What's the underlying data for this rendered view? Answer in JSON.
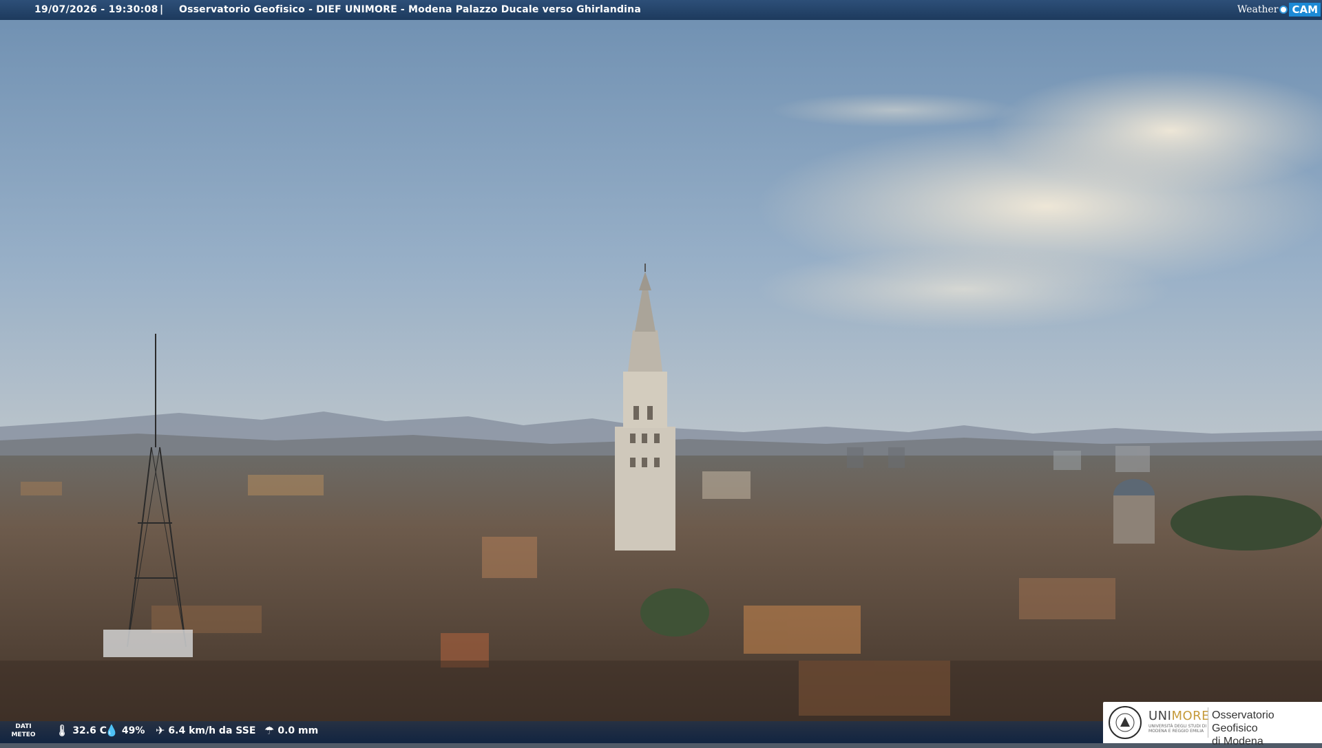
{
  "header": {
    "timestamp": "19/07/2026 - 19:30:08",
    "separator": "|",
    "title": "Osservatorio Geofisico - DIEF UNIMORE - Modena Palazzo Ducale verso Ghirlandina",
    "brand_part1": "Weather",
    "brand_part2": "CAM"
  },
  "weather": {
    "label_line1": "DATI",
    "label_line2": "METEO",
    "temperature": "32.6 C",
    "humidity": "49%",
    "wind": "6.4 km/h da SSE",
    "rain": "0.0 mm",
    "icons": [
      "thermometer-icon",
      "humidity-drop-icon",
      "wind-icon",
      "rain-gauge-icon"
    ]
  },
  "logo": {
    "unimore_a": "UNI",
    "unimore_b": "MORE",
    "university_line1": "UNIVERSITÀ DEGLI STUDI DI",
    "university_line2": "MODENA E REGGIO EMILIA",
    "observatory_line1": "Osservatorio Geofisico",
    "observatory_line2": "di Modena"
  },
  "colors": {
    "bar": "#1d3a5d",
    "brand_accent": "#1c8ad6",
    "unimore_gold": "#c59a3a"
  }
}
